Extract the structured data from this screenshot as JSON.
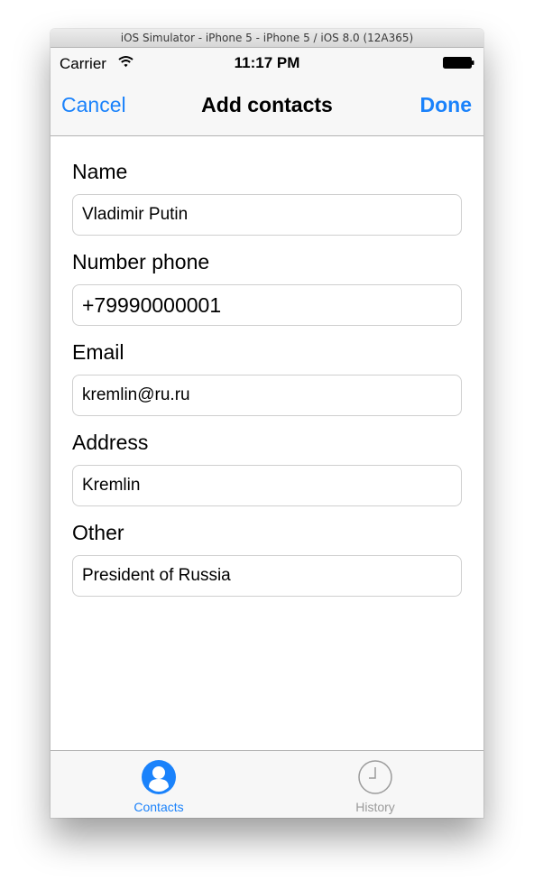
{
  "window": {
    "title": "iOS Simulator - iPhone 5 - iPhone 5 / iOS 8.0 (12A365)"
  },
  "status_bar": {
    "carrier": "Carrier",
    "time": "11:17 PM",
    "wifi_icon": "wifi-icon",
    "battery_icon": "battery-icon"
  },
  "navbar": {
    "cancel_label": "Cancel",
    "title": "Add contacts",
    "done_label": "Done",
    "accent_color": "#1a82fb"
  },
  "form": {
    "fields": [
      {
        "label": "Name",
        "value": "Vladimir Putin"
      },
      {
        "label": "Number phone",
        "value": "+79990000001"
      },
      {
        "label": "Email",
        "value": "kremlin@ru.ru"
      },
      {
        "label": "Address",
        "value": "Kremlin"
      },
      {
        "label": "Other",
        "value": "President of Russia"
      }
    ]
  },
  "tab_bar": {
    "tabs": [
      {
        "label": "Contacts",
        "icon": "person-icon",
        "selected": true
      },
      {
        "label": "History",
        "icon": "clock-icon",
        "selected": false
      }
    ],
    "selected_color": "#1a82fb",
    "unselected_color": "#9b9b9b"
  }
}
